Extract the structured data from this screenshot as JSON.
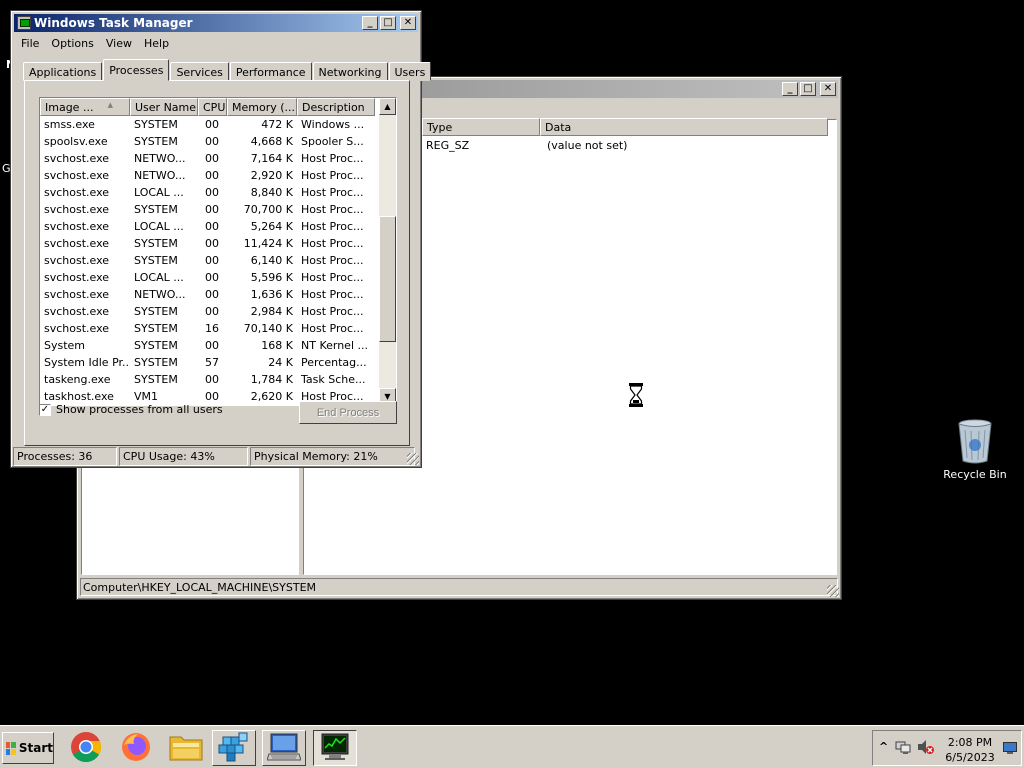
{
  "desktop": {
    "recycle_bin_label": "Recycle Bin",
    "edge_letters": [
      "N",
      "Gr"
    ]
  },
  "registry_window": {
    "columns": [
      "Type",
      "Data"
    ],
    "rows": [
      {
        "type": "REG_SZ",
        "data": "(value not set)"
      }
    ],
    "status_path": "Computer\\HKEY_LOCAL_MACHINE\\SYSTEM",
    "buttons": {
      "minimize": "_",
      "maximize": "□",
      "close": "✕"
    }
  },
  "task_manager": {
    "title": "Windows Task Manager",
    "buttons": {
      "minimize": "_",
      "maximize": "□",
      "close": "✕"
    },
    "menu": [
      "File",
      "Options",
      "View",
      "Help"
    ],
    "tabs": [
      "Applications",
      "Processes",
      "Services",
      "Performance",
      "Networking",
      "Users"
    ],
    "selected_tab": "Processes",
    "columns": [
      "Image ...",
      "User Name",
      "CPU",
      "Memory (...",
      "Description"
    ],
    "processes": [
      {
        "name": "smss.exe",
        "user": "SYSTEM",
        "cpu": "00",
        "mem": "472 K",
        "desc": "Windows ..."
      },
      {
        "name": "spoolsv.exe",
        "user": "SYSTEM",
        "cpu": "00",
        "mem": "4,668 K",
        "desc": "Spooler S..."
      },
      {
        "name": "svchost.exe",
        "user": "NETWO...",
        "cpu": "00",
        "mem": "7,164 K",
        "desc": "Host Proc..."
      },
      {
        "name": "svchost.exe",
        "user": "NETWO...",
        "cpu": "00",
        "mem": "2,920 K",
        "desc": "Host Proc..."
      },
      {
        "name": "svchost.exe",
        "user": "LOCAL ...",
        "cpu": "00",
        "mem": "8,840 K",
        "desc": "Host Proc..."
      },
      {
        "name": "svchost.exe",
        "user": "SYSTEM",
        "cpu": "00",
        "mem": "70,700 K",
        "desc": "Host Proc..."
      },
      {
        "name": "svchost.exe",
        "user": "LOCAL ...",
        "cpu": "00",
        "mem": "5,264 K",
        "desc": "Host Proc..."
      },
      {
        "name": "svchost.exe",
        "user": "SYSTEM",
        "cpu": "00",
        "mem": "11,424 K",
        "desc": "Host Proc..."
      },
      {
        "name": "svchost.exe",
        "user": "SYSTEM",
        "cpu": "00",
        "mem": "6,140 K",
        "desc": "Host Proc..."
      },
      {
        "name": "svchost.exe",
        "user": "LOCAL ...",
        "cpu": "00",
        "mem": "5,596 K",
        "desc": "Host Proc..."
      },
      {
        "name": "svchost.exe",
        "user": "NETWO...",
        "cpu": "00",
        "mem": "1,636 K",
        "desc": "Host Proc..."
      },
      {
        "name": "svchost.exe",
        "user": "SYSTEM",
        "cpu": "00",
        "mem": "2,984 K",
        "desc": "Host Proc..."
      },
      {
        "name": "svchost.exe",
        "user": "SYSTEM",
        "cpu": "16",
        "mem": "70,140 K",
        "desc": "Host Proc..."
      },
      {
        "name": "System",
        "user": "SYSTEM",
        "cpu": "00",
        "mem": "168 K",
        "desc": "NT Kernel ..."
      },
      {
        "name": "System Idle Pr...",
        "user": "SYSTEM",
        "cpu": "57",
        "mem": "24 K",
        "desc": "Percentag..."
      },
      {
        "name": "taskeng.exe",
        "user": "SYSTEM",
        "cpu": "00",
        "mem": "1,784 K",
        "desc": "Task Sche..."
      },
      {
        "name": "taskhost.exe",
        "user": "VM1",
        "cpu": "00",
        "mem": "2,620 K",
        "desc": "Host Proc..."
      }
    ],
    "show_all_users_label": "Show processes from all users",
    "show_all_users_checked": true,
    "end_process_label": "End Process",
    "status": {
      "processes": "Processes: 36",
      "cpu": "CPU Usage: 43%",
      "memory": "Physical Memory: 21%"
    }
  },
  "taskbar": {
    "start_label": "Start",
    "apps": [
      "chrome-icon",
      "firefox-icon",
      "file-explorer-icon",
      "registry-editor-icon",
      "remote-desktop-icon",
      "task-manager-icon"
    ],
    "clock_time": "2:08 PM",
    "clock_date": "6/5/2023",
    "tray_expand": "^"
  },
  "colors": {
    "title_active": "#0a246a",
    "face": "#d4d0c8",
    "desktop": "#000000"
  }
}
